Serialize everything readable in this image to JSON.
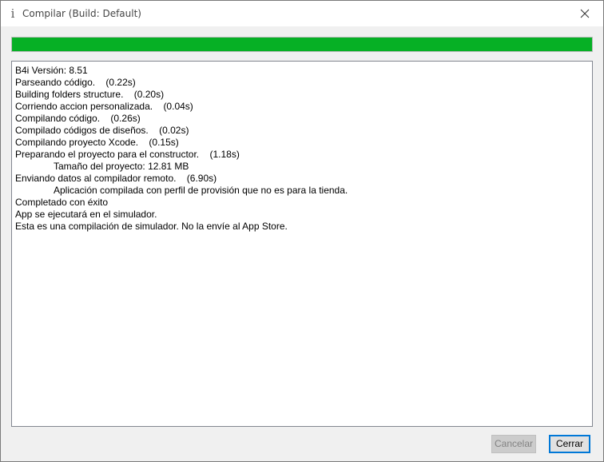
{
  "window": {
    "title": "Compilar (Build: Default)",
    "icon": "info-i-icon"
  },
  "progress": {
    "percent": 100,
    "color": "#06b025"
  },
  "log": {
    "lines": [
      {
        "text": "B4i Versión: 8.51",
        "indent": false
      },
      {
        "text": "Parseando código.    (0.22s)",
        "indent": false
      },
      {
        "text": "Building folders structure.    (0.20s)",
        "indent": false
      },
      {
        "text": "Corriendo accion personalizada.    (0.04s)",
        "indent": false
      },
      {
        "text": "Compilando código.    (0.26s)",
        "indent": false
      },
      {
        "text": "Compilado códigos de diseños.    (0.02s)",
        "indent": false
      },
      {
        "text": "Compilando proyecto Xcode.    (0.15s)",
        "indent": false
      },
      {
        "text": "Preparando el proyecto para el constructor.    (1.18s)",
        "indent": false
      },
      {
        "text": "Tamaño del proyecto: 12.81 MB",
        "indent": true
      },
      {
        "text": "Enviando datos al compilador remoto.    (6.90s)",
        "indent": false
      },
      {
        "text": "Aplicación compilada con perfil de provisión que no es para la tienda.",
        "indent": true
      },
      {
        "text": "Completado con éxito",
        "indent": false
      },
      {
        "text": "App se ejecutará en el simulador.",
        "indent": false
      },
      {
        "text": "Esta es una compilación de simulador. No la envíe al App Store.",
        "indent": false
      }
    ]
  },
  "buttons": {
    "cancel_label": "Cancelar",
    "cancel_enabled": false,
    "close_label": "Cerrar"
  }
}
